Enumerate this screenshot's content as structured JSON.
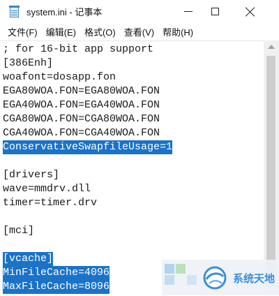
{
  "window": {
    "title": "system.ini - 记事本",
    "icon": "notepad-icon"
  },
  "menu": [
    {
      "label": "文件(F)"
    },
    {
      "label": "编辑(E)"
    },
    {
      "label": "格式(O)"
    },
    {
      "label": "查看(V)"
    },
    {
      "label": "帮助(H)"
    }
  ],
  "editor": {
    "lines": [
      {
        "text": "; for 16-bit app support",
        "selected": false
      },
      {
        "text": "[386Enh]",
        "selected": false
      },
      {
        "text": "woafont=dosapp.fon",
        "selected": false
      },
      {
        "text": "EGA80WOA.FON=EGA80WOA.FON",
        "selected": false
      },
      {
        "text": "EGA40WOA.FON=EGA40WOA.FON",
        "selected": false
      },
      {
        "text": "CGA80WOA.FON=CGA80WOA.FON",
        "selected": false
      },
      {
        "text": "CGA40WOA.FON=CGA40WOA.FON",
        "selected": false
      },
      {
        "text": "ConservativeSwapfileUsage=1",
        "selected": true
      },
      {
        "text": "",
        "selected": false
      },
      {
        "text": "[drivers]",
        "selected": false
      },
      {
        "text": "wave=mmdrv.dll",
        "selected": false
      },
      {
        "text": "timer=timer.drv",
        "selected": false
      },
      {
        "text": "",
        "selected": false
      },
      {
        "text": "[mci]",
        "selected": false
      },
      {
        "text": "",
        "selected": false
      },
      {
        "text": "[vcache]",
        "selected": true
      },
      {
        "text": "MinFileCache=4096",
        "selected": true
      },
      {
        "text": "MaxFileCache=8096",
        "selected": true
      }
    ],
    "selection_color": "#1a73c9"
  },
  "watermark": {
    "text": "系统天地",
    "color": "#3a8fd6"
  }
}
